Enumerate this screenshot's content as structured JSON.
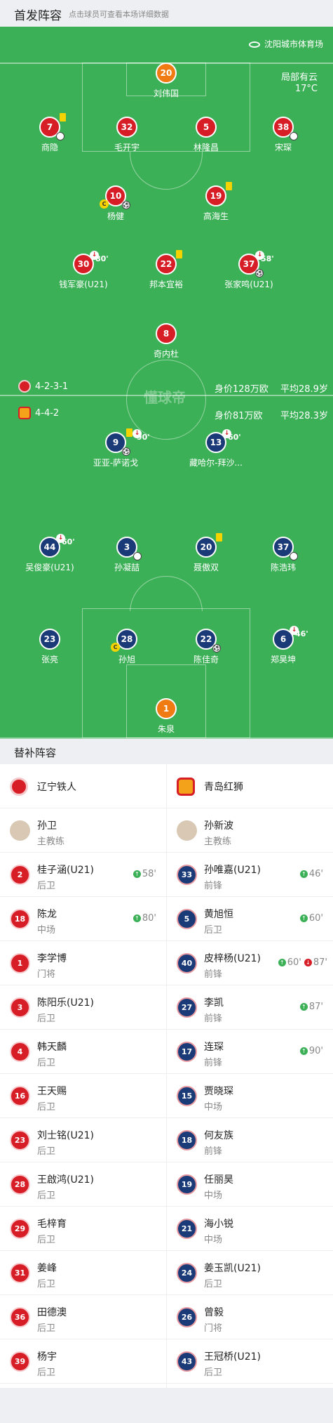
{
  "header": {
    "title": "首发阵容",
    "hint": "点击球员可查看本场详细数据"
  },
  "pitch": {
    "venue": "沈阳城市体育场",
    "weather": "局部有云",
    "temperature": "17°C",
    "watermark": "懂球帝",
    "home_row": {
      "formation": "4-2-3-1",
      "value": "身价128万欧",
      "age": "平均28.9岁"
    },
    "away_row": {
      "formation": "4-4-2",
      "value": "身价81万欧",
      "age": "平均28.3岁"
    }
  },
  "home_players": [
    {
      "num": "20",
      "name": "刘伟国",
      "gk": true
    },
    {
      "num": "7",
      "name": "商隐"
    },
    {
      "num": "32",
      "name": "毛开宇"
    },
    {
      "num": "5",
      "name": "林隆昌"
    },
    {
      "num": "38",
      "name": "宋琛"
    },
    {
      "num": "10",
      "name": "杨健"
    },
    {
      "num": "19",
      "name": "高海生"
    },
    {
      "num": "30",
      "name": "钱军豪(U21)",
      "time": "80'"
    },
    {
      "num": "22",
      "name": "邦本宜裕"
    },
    {
      "num": "37",
      "name": "张家鸣(U21)",
      "time": "58'"
    },
    {
      "num": "8",
      "name": "奇内杜"
    }
  ],
  "away_players": [
    {
      "num": "9",
      "name": "亚亚-萨诺戈",
      "time": "90'"
    },
    {
      "num": "13",
      "name": "藏哈尔-拜沙...",
      "time": "60'"
    },
    {
      "num": "44",
      "name": "吴俊豪(U21)",
      "time": "60'"
    },
    {
      "num": "3",
      "name": "孙凝喆"
    },
    {
      "num": "20",
      "name": "聂傲双"
    },
    {
      "num": "37",
      "name": "陈浩玮"
    },
    {
      "num": "23",
      "name": "张亮"
    },
    {
      "num": "28",
      "name": "孙旭"
    },
    {
      "num": "22",
      "name": "陈佳奇"
    },
    {
      "num": "6",
      "name": "郑昊坤",
      "time": "46'"
    },
    {
      "num": "1",
      "name": "朱泉",
      "gk": true
    }
  ],
  "subs": {
    "title": "替补阵容",
    "home_team": "辽宁铁人",
    "away_team": "青岛红狮",
    "home_coach": {
      "name": "孙卫",
      "role": "主教练"
    },
    "away_coach": {
      "name": "孙新波",
      "role": "主教练"
    },
    "home": [
      {
        "num": "2",
        "name": "桂子涵(U21)",
        "pos": "后卫",
        "time": "58'"
      },
      {
        "num": "18",
        "name": "陈龙",
        "pos": "中场",
        "time": "80'"
      },
      {
        "num": "1",
        "name": "李学博",
        "pos": "门将"
      },
      {
        "num": "3",
        "name": "陈阳乐(U21)",
        "pos": "后卫"
      },
      {
        "num": "4",
        "name": "韩天麟",
        "pos": "后卫"
      },
      {
        "num": "16",
        "name": "王天赐",
        "pos": "后卫"
      },
      {
        "num": "23",
        "name": "刘士铭(U21)",
        "pos": "后卫"
      },
      {
        "num": "28",
        "name": "王啟鸿(U21)",
        "pos": "后卫"
      },
      {
        "num": "29",
        "name": "毛梓育",
        "pos": "后卫"
      },
      {
        "num": "31",
        "name": "姜峰",
        "pos": "后卫"
      },
      {
        "num": "36",
        "name": "田德澳",
        "pos": "后卫"
      },
      {
        "num": "39",
        "name": "杨宇",
        "pos": "后卫"
      }
    ],
    "away": [
      {
        "num": "33",
        "name": "孙唯嘉(U21)",
        "pos": "前锋",
        "time": "46'"
      },
      {
        "num": "5",
        "name": "黄旭恒",
        "pos": "后卫",
        "time": "60'"
      },
      {
        "num": "40",
        "name": "皮梓杨(U21)",
        "pos": "前锋",
        "time_in": "60'",
        "time_out": "87'"
      },
      {
        "num": "27",
        "name": "李凯",
        "pos": "前锋",
        "time": "87'"
      },
      {
        "num": "17",
        "name": "连琛",
        "pos": "前锋",
        "time": "90'"
      },
      {
        "num": "15",
        "name": "贾晓琛",
        "pos": "中场"
      },
      {
        "num": "18",
        "name": "何友族",
        "pos": "前锋"
      },
      {
        "num": "19",
        "name": "任丽昊",
        "pos": "中场"
      },
      {
        "num": "21",
        "name": "海小锐",
        "pos": "中场"
      },
      {
        "num": "24",
        "name": "姜玉凯(U21)",
        "pos": "后卫"
      },
      {
        "num": "26",
        "name": "曾毅",
        "pos": "门将"
      },
      {
        "num": "43",
        "name": "王冠桥(U21)",
        "pos": "后卫"
      }
    ]
  }
}
